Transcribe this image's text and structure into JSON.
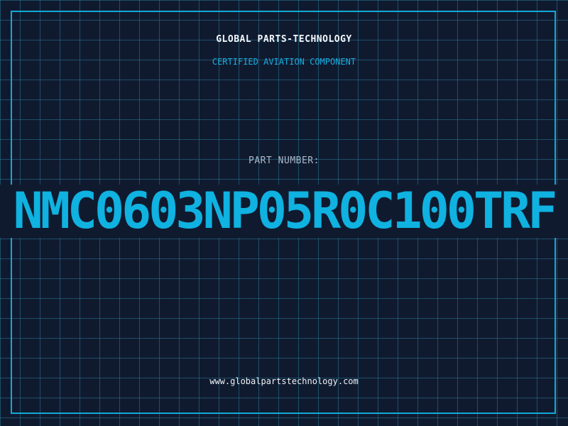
{
  "header": {
    "company": "GLOBAL PARTS-TECHNOLOGY",
    "tagline": "CERTIFIED AVIATION COMPONENT"
  },
  "part": {
    "label": "PART NUMBER:",
    "number": "NMC0603NP05R0C100TRF"
  },
  "footer": {
    "website": "www.globalpartstechnology.com"
  },
  "colors": {
    "background": "#101a2f",
    "grid": "#28789a",
    "accent": "#12a9d6",
    "text": "#f2f6fa",
    "label": "#aab8c8"
  }
}
